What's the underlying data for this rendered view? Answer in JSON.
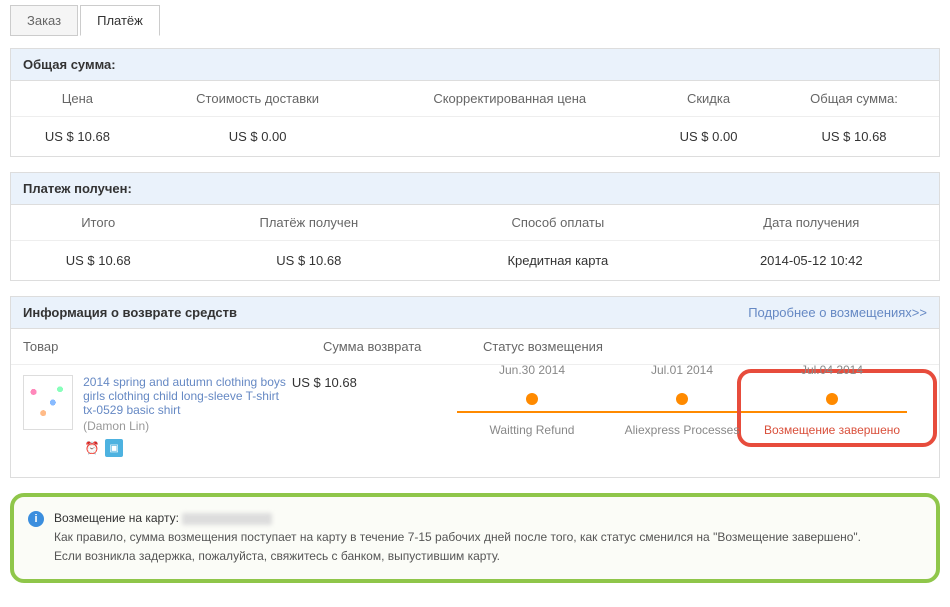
{
  "tabs": {
    "order": "Заказ",
    "payment": "Платёж"
  },
  "total_section": {
    "title": "Общая сумма:",
    "headers": [
      "Цена",
      "Стоимость доставки",
      "Скорректированная цена",
      "Скидка",
      "Общая сумма:"
    ],
    "values": [
      "US $ 10.68",
      "US $ 0.00",
      "",
      "US $ 0.00",
      "US $ 10.68"
    ]
  },
  "received_section": {
    "title": "Платеж получен:",
    "headers": [
      "Итого",
      "Платёж получен",
      "Способ оплаты",
      "Дата получения"
    ],
    "values": [
      "US $ 10.68",
      "US $ 10.68",
      "Кредитная карта",
      "2014-05-12 10:42"
    ]
  },
  "refund_section": {
    "title": "Информация о возврате средств",
    "more_link": "Подробнее о возмещениях>>",
    "cols": {
      "product": "Товар",
      "amount": "Сумма возврата",
      "status": "Статус возмещения"
    },
    "product": {
      "name": "2014 spring and autumn clothing boys girls clothing child long-sleeve T-shirt tx-0529 basic shirt",
      "vendor": "(Damon Lin)"
    },
    "amount": "US $ 10.68",
    "timeline": [
      {
        "date": "Jun.30 2014",
        "label": "Waitting Refund"
      },
      {
        "date": "Jul.01 2014",
        "label": "Aliexpress Processes"
      },
      {
        "date": "Jul.04 2014",
        "label": "Возмещение завершено"
      }
    ]
  },
  "info": {
    "lead": "Возмещение на карту:",
    "line2": "Как правило, сумма возмещения поступает на карту в течение 7-15 рабочих дней после того, как статус сменился на \"Возмещение завершено\".",
    "line3": "Если возникла задержка, пожалуйста, свяжитесь с банком, выпустившим карту."
  }
}
